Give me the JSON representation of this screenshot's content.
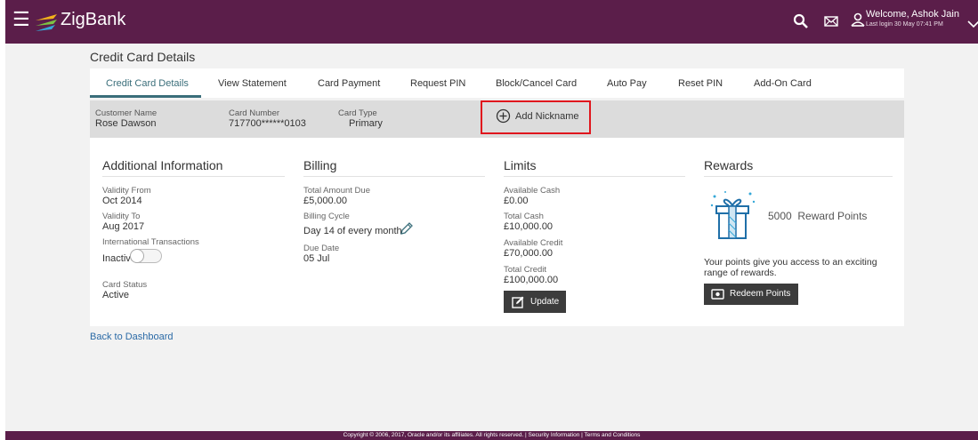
{
  "header": {
    "brand": "ZigBank",
    "welcome": "Welcome, Ashok Jain",
    "last_login": "Last login 30 May 07:41 PM",
    "icons": [
      "hamburger-menu-icon",
      "zigbank-logo-icon",
      "search-icon",
      "mail-icon",
      "user-icon",
      "chevron-down-icon"
    ],
    "colors": {
      "header_bg": "#5b1e4a",
      "accent": "#3a6e7a",
      "highlight": "#e0161d"
    }
  },
  "page": {
    "title": "Credit Card Details"
  },
  "tabs": [
    {
      "label": "Credit Card Details"
    },
    {
      "label": "View Statement"
    },
    {
      "label": "Card Payment"
    },
    {
      "label": "Request PIN"
    },
    {
      "label": "Block/Cancel Card"
    },
    {
      "label": "Auto Pay"
    },
    {
      "label": "Reset PIN"
    },
    {
      "label": "Add-On Card"
    }
  ],
  "summary": {
    "customer_name_label": "Customer Name",
    "customer_name": "Rose Dawson",
    "card_number_label": "Card Number",
    "card_number": "717700******0103",
    "card_type_label": "Card Type",
    "card_type": "Primary",
    "add_nickname": "Add Nickname"
  },
  "additional": {
    "title": "Additional Information",
    "validity_from_label": "Validity From",
    "validity_from": "Oct 2014",
    "validity_to_label": "Validity To",
    "validity_to": "Aug 2017",
    "intl_label": "International Transactions",
    "intl_value": "Inactive",
    "status_label": "Card Status",
    "status": "Active"
  },
  "billing": {
    "title": "Billing",
    "total_due_label": "Total Amount Due",
    "total_due": "£5,000.00",
    "cycle_label": "Billing Cycle",
    "cycle": "Day 14 of every month",
    "due_date_label": "Due Date",
    "due_date": "05 Jul"
  },
  "limits": {
    "title": "Limits",
    "avail_cash_label": "Available Cash",
    "avail_cash": "£0.00",
    "total_cash_label": "Total Cash",
    "total_cash": "£10,000.00",
    "avail_credit_label": "Available Credit",
    "avail_credit": "£70,000.00",
    "total_credit_label": "Total Credit",
    "total_credit": "£100,000.00",
    "update_button": "Update"
  },
  "rewards": {
    "title": "Rewards",
    "points": "5000",
    "points_label": "Reward Points",
    "description": "Your points give you access to an exciting range of rewards.",
    "redeem_button": "Redeem Points"
  },
  "back_link": "Back to Dashboard",
  "footer": "Copyright © 2006, 2017, Oracle and/or its affiliates. All rights reserved. | Security Information | Terms and Conditions"
}
